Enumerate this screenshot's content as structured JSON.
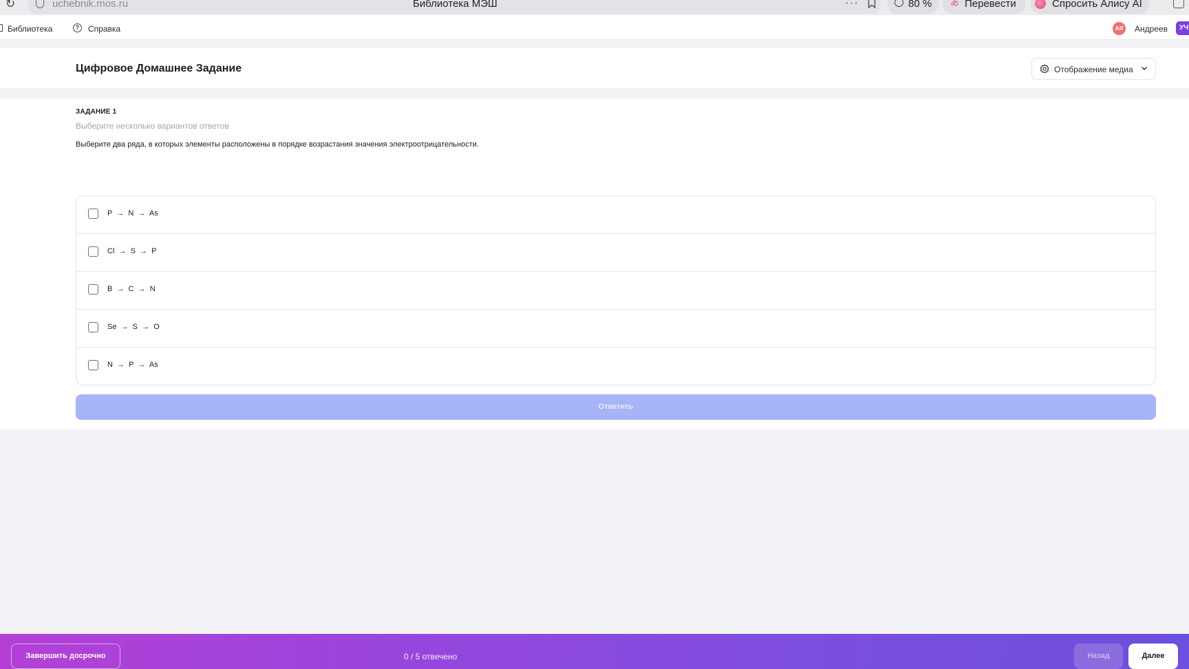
{
  "browser": {
    "url": "uchebnik.mos.ru",
    "tab_title": "Библиотека МЭШ",
    "zoom": "80 %",
    "translate_label": "Перевести",
    "alice_label": "Спросить Алису AI"
  },
  "nav": {
    "library_label": "Библиотека",
    "help_label": "Справка",
    "avatar_initials": "АЯ",
    "user_name": "Андреев",
    "role_badge": "УЧ"
  },
  "header": {
    "title": "Цифровое Домашнее Задание",
    "media_button_label": "Отображение медиа"
  },
  "task": {
    "number_label": "ЗАДАНИЕ 1",
    "hint": "Выберите несколько вариантов ответов",
    "question": "Выберите два ряда, в которых элементы расположены в порядке возрастания значения электроотрицательности.",
    "options": [
      {
        "label": "P  →  N  →  As",
        "checked": false
      },
      {
        "label": "Cl  →  S  →  P",
        "checked": false
      },
      {
        "label": "B  →  C  →  N",
        "checked": false
      },
      {
        "label": "Se  →  S  →  O",
        "checked": false
      },
      {
        "label": "N  →  P  →  As",
        "checked": false
      }
    ],
    "answer_button_label": "Ответить"
  },
  "footer": {
    "finish_button_label": "Завершить досрочно",
    "progress_text": "0 / 5 отвечено",
    "back_button_label": "Назад",
    "next_button_label": "Далее"
  },
  "colors": {
    "accent": "#7e4ddf",
    "answer_button_disabled": "#a6b5f8",
    "avatar": "#f07070",
    "role_badge": "#7b3fe0"
  }
}
